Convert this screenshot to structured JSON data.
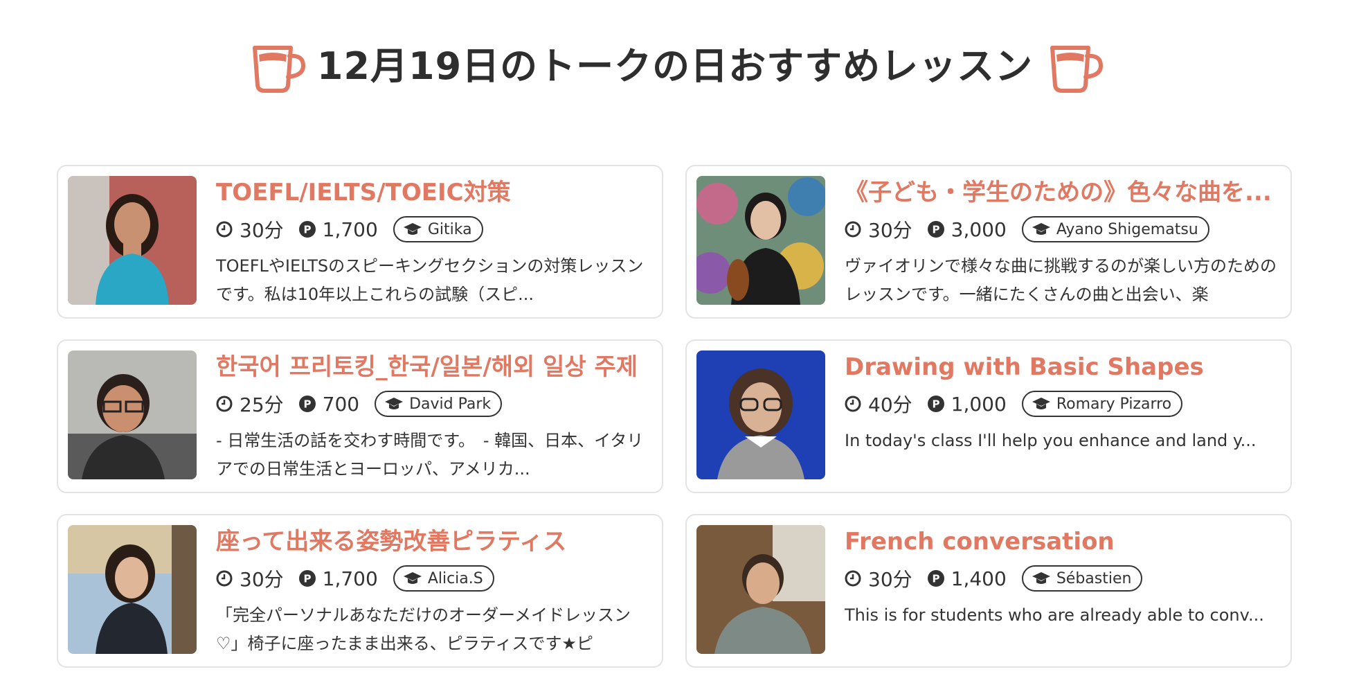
{
  "header": {
    "title": "12月19日のトークの日おすすめレッスン",
    "icon_left": "coffee-cup-icon",
    "icon_right": "coffee-cup-icon"
  },
  "colors": {
    "accent": "#e07862",
    "text": "#333333",
    "border": "#e3e3e3"
  },
  "lessons": [
    {
      "title": "TOEFL/IELTS/TOEIC対策",
      "duration": "30分",
      "points": "1,700",
      "teacher": "Gitika",
      "description": "TOEFLやIELTSのスピーキングセクションの対策レッスンです。私は10年以上これらの試験（スピ..."
    },
    {
      "title": "《子ども・学生のための》色々な曲を...",
      "duration": "30分",
      "points": "3,000",
      "teacher": "Ayano Shigematsu",
      "description": "ヴァイオリンで様々な曲に挑戦するのが楽しい方のためのレッスンです。一緒にたくさんの曲と出会い、楽"
    },
    {
      "title": "한국어 프리토킹_한국/일본/해외 일상 주제",
      "duration": "25分",
      "points": "700",
      "teacher": "David Park",
      "description": "- 日常生活の話を交わす時間です。　- 韓国、日本、イタリアでの日常生活とヨーロッパ、アメリカ..."
    },
    {
      "title": "Drawing with Basic Shapes",
      "duration": "40分",
      "points": "1,000",
      "teacher": "Romary Pizarro",
      "description": "In today's class I'll help you enhance and land y..."
    },
    {
      "title": "座って出来る姿勢改善ピラティス",
      "duration": "30分",
      "points": "1,700",
      "teacher": "Alicia.S",
      "description": "「完全パーソナルあなただけのオーダーメイドレッスン♡」椅子に座ったまま出来る、ピラティスです★ピ"
    },
    {
      "title": "French conversation",
      "duration": "30分",
      "points": "1,400",
      "teacher": "Sébastien",
      "description": "This is for students who are already able to conv..."
    }
  ]
}
